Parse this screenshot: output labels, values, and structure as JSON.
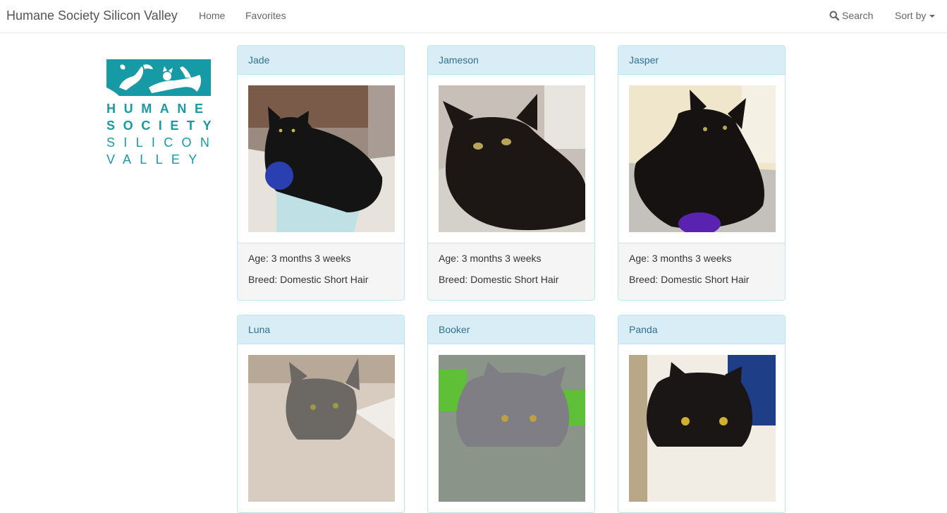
{
  "nav": {
    "brand": "Humane Society Silicon Valley",
    "home": "Home",
    "favorites": "Favorites",
    "search": "Search",
    "sort": "Sort by"
  },
  "logo": {
    "lines": [
      "HUMANE",
      "SOCIETY",
      "SILICON",
      "VALLEY"
    ],
    "color": "#169aa6"
  },
  "pets": [
    {
      "name": "Jade",
      "age": "Age: 3 months 3 weeks",
      "breed": "Breed: Domestic Short Hair"
    },
    {
      "name": "Jameson",
      "age": "Age: 3 months 3 weeks",
      "breed": "Breed: Domestic Short Hair"
    },
    {
      "name": "Jasper",
      "age": "Age: 3 months 3 weeks",
      "breed": "Breed: Domestic Short Hair"
    },
    {
      "name": "Luna"
    },
    {
      "name": "Booker"
    },
    {
      "name": "Panda"
    }
  ],
  "colors": {
    "panel_heading": "#d9edf7",
    "panel_border": "#bce8f1",
    "panel_title": "#31708f",
    "panel_footer": "#f5f5f5"
  }
}
